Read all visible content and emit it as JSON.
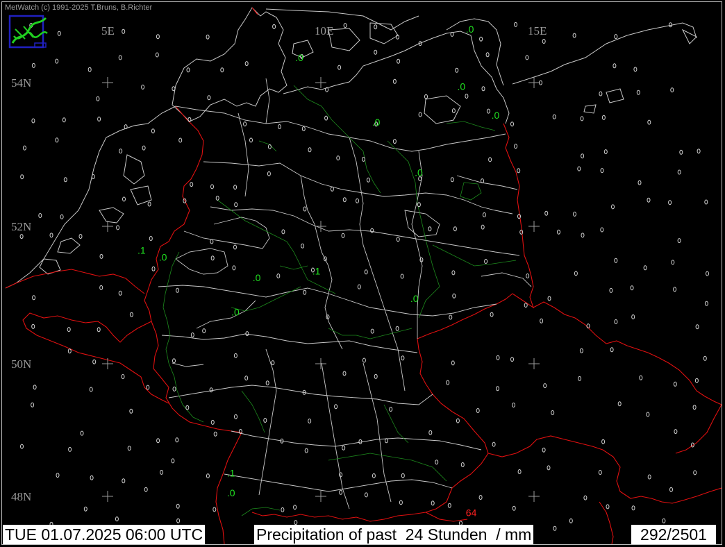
{
  "header": {
    "copyright": "MetWatch  (c) 1991-2025 T.Bruns, B.Richter",
    "logo": "metwatch-logo-icon"
  },
  "grid": {
    "longitudes": [
      "5E",
      "10E",
      "15E"
    ],
    "latitudes": [
      "54N",
      "52N",
      "50N",
      "48N"
    ]
  },
  "observations": {
    "values": [
      {
        "lon": 9.4,
        "lat": 54.3,
        "text": ".0",
        "color": "#20e020"
      },
      {
        "lon": 13.4,
        "lat": 54.7,
        "text": ".0",
        "color": "#20e020"
      },
      {
        "lon": 13.2,
        "lat": 53.9,
        "text": ".0",
        "color": "#20e020"
      },
      {
        "lon": 14.0,
        "lat": 53.5,
        "text": ".0",
        "color": "#20e020"
      },
      {
        "lon": 11.2,
        "lat": 53.4,
        "text": ".0",
        "color": "#20e020"
      },
      {
        "lon": 12.2,
        "lat": 52.7,
        "text": ".0",
        "color": "#20e020"
      },
      {
        "lon": 5.7,
        "lat": 51.6,
        "text": ".1",
        "color": "#20e020"
      },
      {
        "lon": 6.2,
        "lat": 51.5,
        "text": ".0",
        "color": "#20e020"
      },
      {
        "lon": 8.4,
        "lat": 51.2,
        "text": ".0",
        "color": "#20e020"
      },
      {
        "lon": 9.8,
        "lat": 51.3,
        "text": ".1",
        "color": "#20e020"
      },
      {
        "lon": 12.1,
        "lat": 50.9,
        "text": ".0",
        "color": "#20e020"
      },
      {
        "lon": 7.9,
        "lat": 50.7,
        "text": ".0",
        "color": "#20e020"
      },
      {
        "lon": 7.8,
        "lat": 48.3,
        "text": ".1",
        "color": "#20e020"
      },
      {
        "lon": 7.8,
        "lat": 48.0,
        "text": ".0",
        "color": "#20e020"
      },
      {
        "lon": 13.4,
        "lat": 47.7,
        "text": "64",
        "color": "#ff2020"
      }
    ]
  },
  "footer": {
    "datetime": "TUE 01.07.2025 06:00 UTC",
    "title": "Precipitation of past  24 Stunden  / mm",
    "count": "292/2501"
  },
  "colors": {
    "background": "#000000",
    "coastline": "#c8c8c8",
    "national_border": "#e01010",
    "river": "#1d8a1d",
    "low_value": "#20e020",
    "high_value": "#ff2020"
  }
}
